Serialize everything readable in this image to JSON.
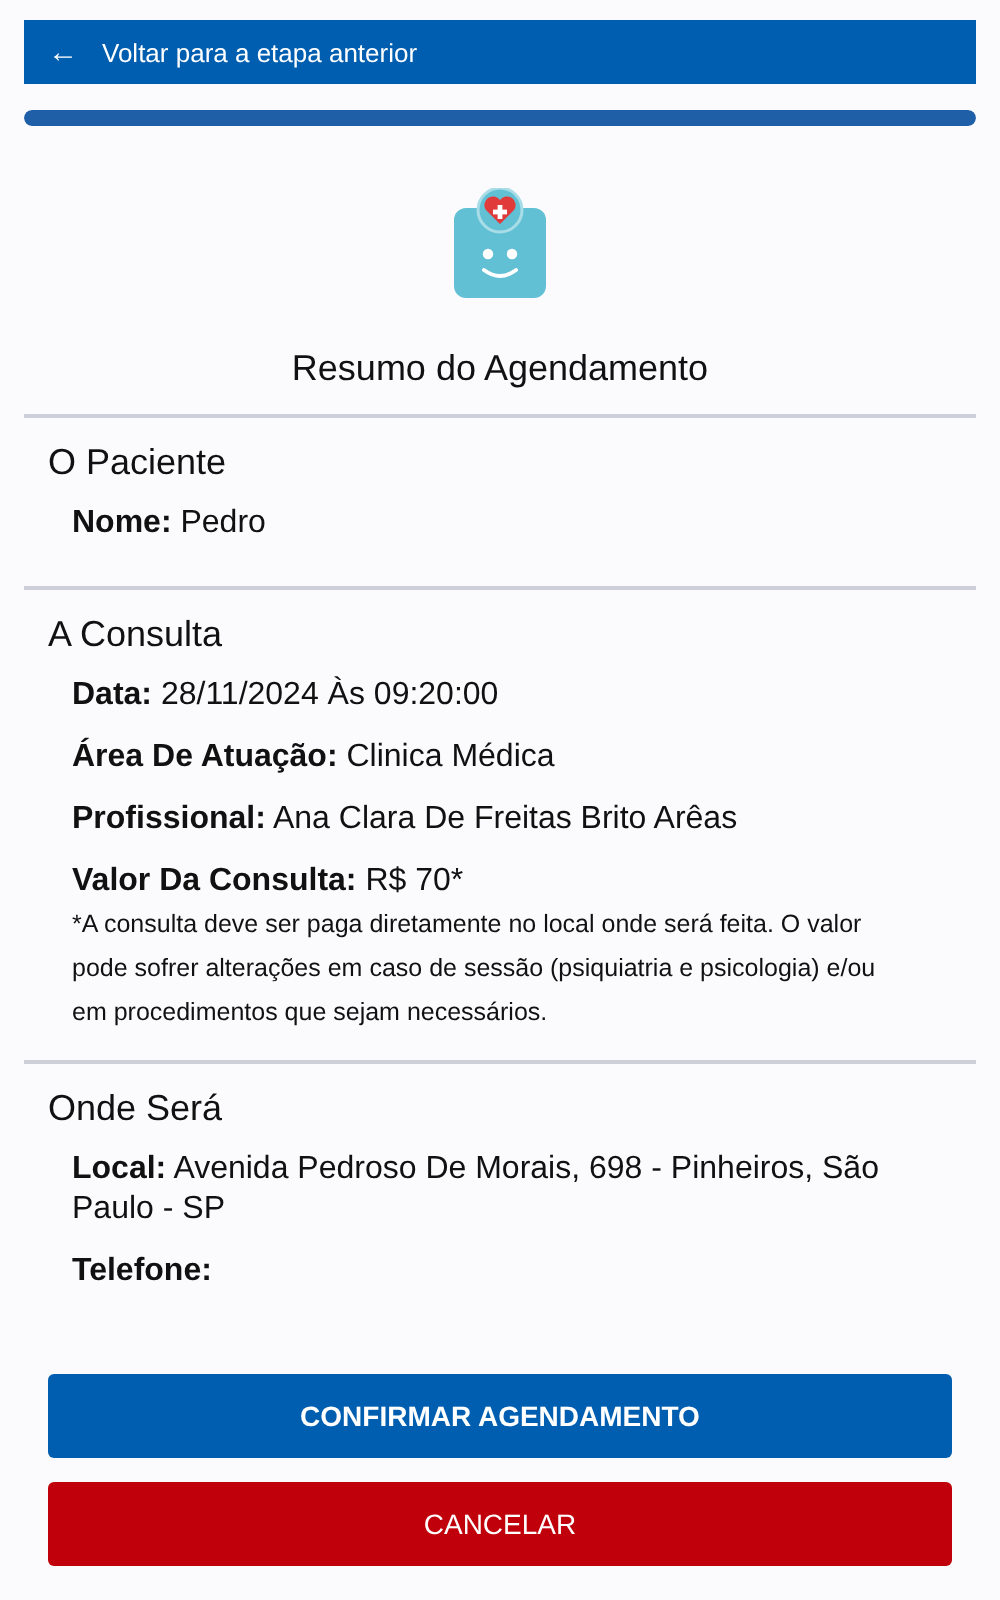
{
  "back_bar": {
    "icon": "←",
    "label": "Voltar para a etapa anterior"
  },
  "progress": {
    "level": 1
  },
  "title": "Resumo do Agendamento",
  "sections": [
    {
      "heading": "O Paciente",
      "fields": [
        {
          "label": "Nome:",
          "value": "Pedro"
        }
      ]
    },
    {
      "heading": "A Consulta",
      "fields": [
        {
          "label": "Data:",
          "value": "28/11/2024 Às 09:20:00"
        },
        {
          "label": "Área De Atuação:",
          "value": "Clinica Médica"
        },
        {
          "label": "Profissional:",
          "value": "Ana Clara De Freitas Brito Arêas"
        },
        {
          "label": "Valor Da Consulta:",
          "value": "R$ 70*"
        }
      ],
      "note": "*A consulta deve ser paga diretamente no local onde será feita. O valor pode sofrer alterações em caso de sessão (psiquiatria e psicologia) e/ou em procedimentos que sejam necessários."
    },
    {
      "heading": "Onde Será",
      "fields": [
        {
          "label": "Local:",
          "value": "Avenida Pedroso De Morais, 698 - Pinheiros, São Paulo - SP"
        },
        {
          "label": "Telefone:"
        }
      ]
    }
  ],
  "buttons": [
    {
      "kind": "primary",
      "label": "CONFIRMAR AGENDAMENTO"
    },
    {
      "kind": "danger",
      "label": "CANCELAR"
    }
  ]
}
